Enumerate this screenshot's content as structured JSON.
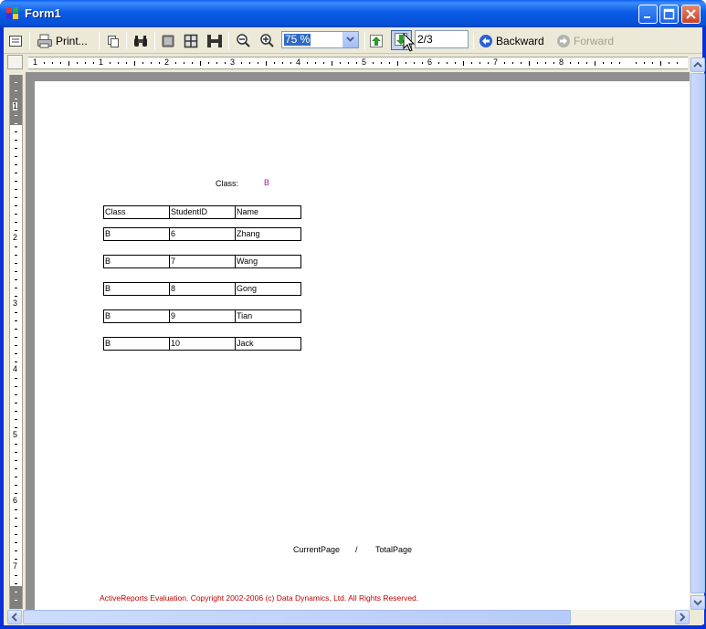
{
  "window": {
    "title": "Form1"
  },
  "toolbar": {
    "print_label": "Print...",
    "zoom_value": "75 %",
    "page_value": "2/3",
    "backward_label": "Backward",
    "forward_label": "Forward"
  },
  "ruler": {
    "h_labels": [
      "1",
      "2",
      "3",
      "4",
      "5",
      "6",
      "7",
      "8"
    ],
    "v_labels": [
      "1",
      "2",
      "3",
      "4",
      "5",
      "6",
      "7"
    ],
    "h_zero": "1"
  },
  "report": {
    "class_label": "Class:",
    "class_value": "B",
    "columns": [
      "Class",
      "StudentID",
      "Name"
    ],
    "rows": [
      [
        "B",
        "6",
        "Zhang"
      ],
      [
        "B",
        "7",
        "Wang"
      ],
      [
        "B",
        "8",
        "Gong"
      ],
      [
        "B",
        "9",
        "Tian"
      ],
      [
        "B",
        "10",
        "Jack"
      ]
    ],
    "current_page_label": "CurrentPage",
    "page_separator": "/",
    "total_page_label": "TotalPage",
    "copyright": "ActiveReports Evaluation. Copyright 2002-2006 (c) Data Dynamics, Ltd. All Rights Reserved."
  },
  "colors": {
    "class_value": "#a0209c",
    "copyright": "#c00000",
    "title_bar": "#0a5ce8"
  }
}
